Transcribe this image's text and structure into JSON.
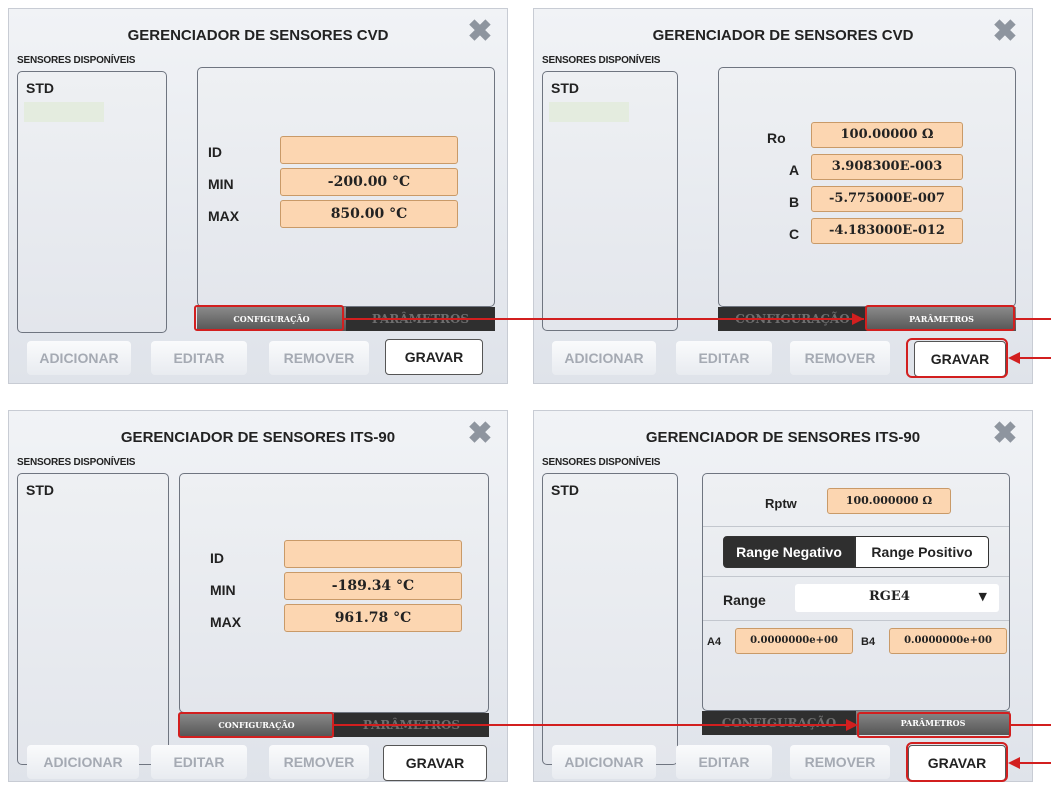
{
  "panels": [
    {
      "title": "GERENCIADOR DE SENSORES CVD",
      "subtitle": "SENSORES DISPONÍVEIS",
      "list_item": "STD",
      "labels": [
        "ID",
        "MIN",
        "MAX"
      ],
      "values": [
        "",
        "-200.00 °C",
        "850.00 °C"
      ],
      "tabs": [
        "CONFIGURAÇÃO",
        "PARÂMETROS"
      ],
      "buttons": [
        "ADICIONAR",
        "EDITAR",
        "REMOVER",
        "GRAVAR"
      ]
    },
    {
      "title": "GERENCIADOR DE SENSORES CVD",
      "subtitle": "SENSORES DISPONÍVEIS",
      "list_item": "STD",
      "labels": [
        "Ro",
        "A",
        "B",
        "C"
      ],
      "values": [
        "100.00000 Ω",
        "3.908300E-003",
        "-5.775000E-007",
        "-4.183000E-012"
      ],
      "tabs": [
        "CONFIGURAÇÃO",
        "PARÂMETROS"
      ],
      "buttons": [
        "ADICIONAR",
        "EDITAR",
        "REMOVER",
        "GRAVAR"
      ]
    },
    {
      "title": "GERENCIADOR DE SENSORES ITS-90",
      "subtitle": "SENSORES DISPONÍVEIS",
      "list_item": "STD",
      "labels": [
        "ID",
        "MIN",
        "MAX"
      ],
      "values": [
        "",
        "-189.34 °C",
        "961.78 °C"
      ],
      "tabs": [
        "CONFIGURAÇÃO",
        "PARÂMETROS"
      ],
      "buttons": [
        "ADICIONAR",
        "EDITAR",
        "REMOVER",
        "GRAVAR"
      ]
    },
    {
      "title": "GERENCIADOR DE SENSORES ITS-90",
      "subtitle": "SENSORES DISPONÍVEIS",
      "list_item": "STD",
      "rptw_label": "Rptw",
      "rptw_value": "100.000000 Ω",
      "range_negative": "Range Negativo",
      "range_positive": "Range Positivo",
      "range_label": "Range",
      "range_value": "RGE4",
      "a4_label": "A4",
      "a4_value": "0.0000000e+00",
      "b4_label": "B4",
      "b4_value": "0.0000000e+00",
      "tabs": [
        "CONFIGURAÇÃO",
        "PARÂMETROS"
      ],
      "buttons": [
        "ADICIONAR",
        "EDITAR",
        "REMOVER",
        "GRAVAR"
      ]
    }
  ],
  "icons": {
    "close": "close-x-icon",
    "dropdown": "caret-down-icon"
  },
  "annotation_color": "#d21f1f",
  "close_glyph": "✖"
}
